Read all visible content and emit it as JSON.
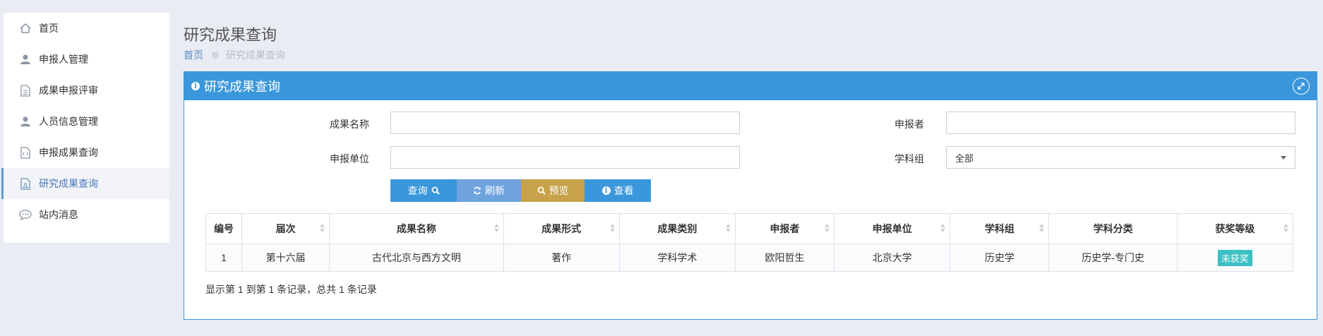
{
  "sidebar": {
    "items": [
      {
        "label": "首页",
        "icon": "home-icon",
        "active": false
      },
      {
        "label": "申报人管理",
        "icon": "user-icon",
        "active": false
      },
      {
        "label": "成果申报评审",
        "icon": "document-icon",
        "active": false
      },
      {
        "label": "人员信息管理",
        "icon": "user-icon",
        "active": false
      },
      {
        "label": "申报成果查询",
        "icon": "code-file-icon",
        "active": false
      },
      {
        "label": "研究成果查询",
        "icon": "flask-file-icon",
        "active": true
      },
      {
        "label": "站内消息",
        "icon": "chat-icon",
        "active": false
      }
    ]
  },
  "page": {
    "title": "研究成果查询",
    "breadcrumb": {
      "home": "首页",
      "current": "研究成果查询"
    }
  },
  "panel": {
    "title": "研究成果查询",
    "form": {
      "name_label": "成果名称",
      "name_value": "",
      "applicant_label": "申报者",
      "applicant_value": "",
      "unit_label": "申报单位",
      "unit_value": "",
      "group_label": "学科组",
      "group_value": "全部"
    },
    "buttons": {
      "query": "查询",
      "refresh": "刷新",
      "preview": "预览",
      "view": "查看"
    },
    "table": {
      "headers": [
        "编号",
        "届次",
        "成果名称",
        "成果形式",
        "成果类别",
        "申报者",
        "申报单位",
        "学科组",
        "学科分类",
        "获奖等级"
      ],
      "rows": [
        [
          "1",
          "第十六届",
          "古代北京与西方文明",
          "著作",
          "学科学术",
          "欧阳哲生",
          "北京大学",
          "历史学",
          "历史学-专门史",
          "未获奖"
        ]
      ]
    },
    "pager_text": "显示第 1 到第 1 条记录，总共 1 条记录"
  },
  "colors": {
    "accent": "#3a97dc",
    "refresh": "#6fa3de",
    "preview": "#c7a24a",
    "badge": "#3bc0c3"
  }
}
